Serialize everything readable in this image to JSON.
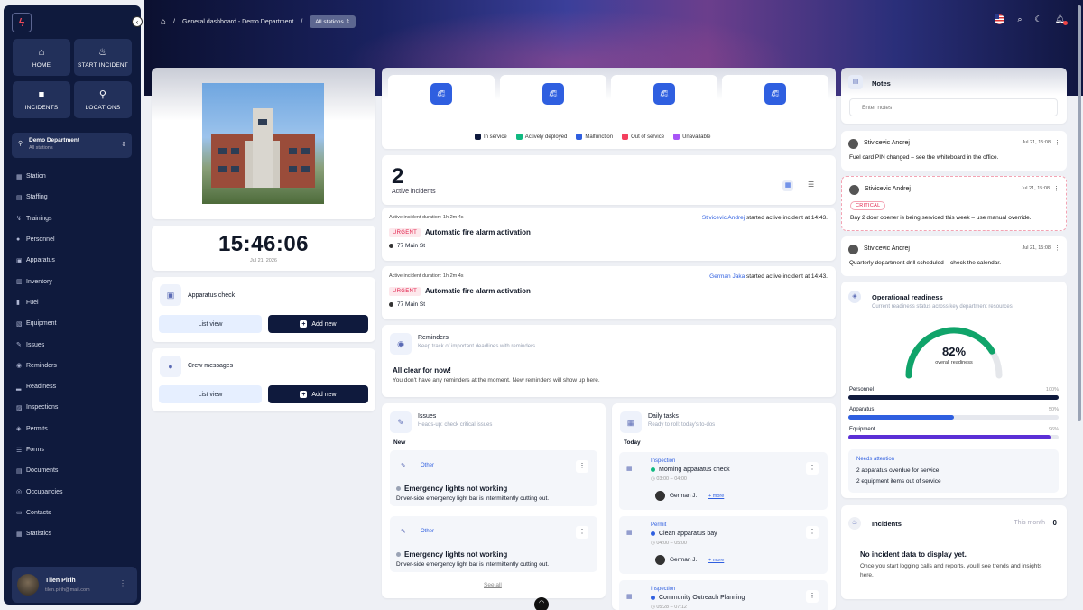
{
  "sidebar": {
    "collapse_icon": "chevron-left-icon",
    "quick": [
      {
        "label": "HOME",
        "icon": "⌂"
      },
      {
        "label": "START INCIDENT",
        "icon": "♨"
      },
      {
        "label": "INCIDENTS",
        "icon": "■"
      },
      {
        "label": "LOCATIONS",
        "icon": "⚲"
      }
    ],
    "department": {
      "name": "Demo Department",
      "sub": "All stations"
    },
    "nav": [
      {
        "label": "Station",
        "icon": "▦"
      },
      {
        "label": "Staffing",
        "icon": "▤"
      },
      {
        "label": "Trainings",
        "icon": "↯"
      },
      {
        "label": "Personnel",
        "icon": "●"
      },
      {
        "label": "Apparatus",
        "icon": "▣"
      },
      {
        "label": "Inventory",
        "icon": "▥"
      },
      {
        "label": "Fuel",
        "icon": "▮"
      },
      {
        "label": "Equipment",
        "icon": "▧"
      },
      {
        "label": "Issues",
        "icon": "✎"
      },
      {
        "label": "Reminders",
        "icon": "◉"
      },
      {
        "label": "Readiness",
        "icon": "▂"
      },
      {
        "label": "Inspections",
        "icon": "▨"
      },
      {
        "label": "Permits",
        "icon": "◈"
      },
      {
        "label": "Forms",
        "icon": "☰"
      },
      {
        "label": "Documents",
        "icon": "▤"
      },
      {
        "label": "Occupancies",
        "icon": "◎"
      },
      {
        "label": "Contacts",
        "icon": "▭"
      },
      {
        "label": "Statistics",
        "icon": "▦"
      }
    ],
    "user": {
      "name": "Tilen Pirih",
      "email": "tilen.pirih@mail.com"
    }
  },
  "topbar": {
    "breadcrumb": "General dashboard - Demo Department",
    "separator": "/",
    "stations": "All stations ⇕"
  },
  "clock": {
    "time": "15:46:06",
    "date": "Jul 21, 2026"
  },
  "apparatus_check": {
    "title": "Apparatus check",
    "list": "List view",
    "add": "Add new",
    "add_icon": "+"
  },
  "crew_messages": {
    "title": "Crew messages",
    "list": "List view",
    "add": "Add new",
    "add_icon": "+"
  },
  "apparatus_legend": [
    {
      "label": "In service",
      "color": "#0f1a3d"
    },
    {
      "label": "Actively deployed",
      "color": "#10b981"
    },
    {
      "label": "Malfunction",
      "color": "#2f5fe0"
    },
    {
      "label": "Out of service",
      "color": "#f43f5e"
    },
    {
      "label": "Unavailable",
      "color": "#a855f7"
    }
  ],
  "incidents_summary": {
    "count": "2",
    "label": "Active incidents"
  },
  "incidents": [
    {
      "duration": "Active incident duration: 1h 2m 4s",
      "user": "Stivicevic Andrej",
      "action": "started active incident at 14:43.",
      "badge": "URGENT",
      "title": "Automatic fire alarm activation",
      "address": "77 Main St"
    },
    {
      "duration": "Active incident duration: 1h 2m 4s",
      "user": "German Jaka",
      "action": "started active incident at 14:43.",
      "badge": "URGENT",
      "title": "Automatic fire alarm activation",
      "address": "77 Main St"
    }
  ],
  "reminders": {
    "title": "Reminders",
    "sub": "Keep track of important deadlines with reminders",
    "empty_title": "All clear for now!",
    "empty_text": "You don't have any reminders at the moment. New reminders will show up here."
  },
  "issues": {
    "title": "Issues",
    "sub": "Heads-up: check critical issues",
    "group": "New",
    "items": [
      {
        "tag": "Other",
        "title": "Emergency lights not working",
        "desc": "Driver-side emergency light bar is intermittently cutting out."
      },
      {
        "tag": "Other",
        "title": "Emergency lights not working",
        "desc": "Driver-side emergency light bar is intermittently cutting out."
      }
    ],
    "see_all": "See all"
  },
  "daily_tasks": {
    "title": "Daily tasks",
    "sub": "Ready to roll: today's to-dos",
    "group": "Today",
    "items": [
      {
        "type": "Inspection",
        "title": "Morning apparatus check",
        "time": "03:00 – 04:00",
        "user": "German J.",
        "more": "+ more",
        "dot": "#10b981"
      },
      {
        "type": "Permit",
        "title": "Clean apparatus bay",
        "time": "04:00 – 05:00",
        "user": "German J.",
        "more": "+ more",
        "dot": "#2f5fe0"
      },
      {
        "type": "Inspection",
        "title": "Community Outreach Planning",
        "time": "05:28 – 07:12",
        "dot": "#2f5fe0"
      }
    ]
  },
  "notes": {
    "title": "Notes",
    "placeholder": "Enter notes",
    "items": [
      {
        "author": "Stivicevic Andrej",
        "time": "Jul 21, 15:08",
        "text": "Fuel card PIN changed – see the whiteboard in the office."
      },
      {
        "author": "Stivicevic Andrej",
        "time": "Jul 21, 15:08",
        "badge": "CRITICAL",
        "text": "Bay 2 door opener is being serviced this week – use manual override."
      },
      {
        "author": "Stivicevic Andrej",
        "time": "Jul 21, 15:08",
        "text": "Quarterly department drill scheduled – check the calendar."
      }
    ]
  },
  "readiness": {
    "title": "Operational readiness",
    "sub": "Current readiness status across key department resources",
    "overall": 0.82,
    "overall_label": "82%",
    "overall_sub": "overall readiness",
    "bars": [
      {
        "label": "Personnel",
        "pct_label": "100%",
        "value": 1.0,
        "color": "#0f1a3d"
      },
      {
        "label": "Apparatus",
        "pct_label": "50%",
        "value": 0.5,
        "color": "#2f5fe0"
      },
      {
        "label": "Equipment",
        "pct_label": "96%",
        "value": 0.96,
        "color": "#5b2fd6"
      }
    ],
    "attention_title": "Needs attention",
    "attention": [
      "2 apparatus overdue for service",
      "2 equipment items out of service"
    ]
  },
  "incident_stats": {
    "title": "Incidents",
    "period": "This month",
    "count": "0",
    "empty_title": "No incident data to display yet.",
    "empty_text": "Once you start logging calls and reports, you'll see trends and insights here."
  }
}
